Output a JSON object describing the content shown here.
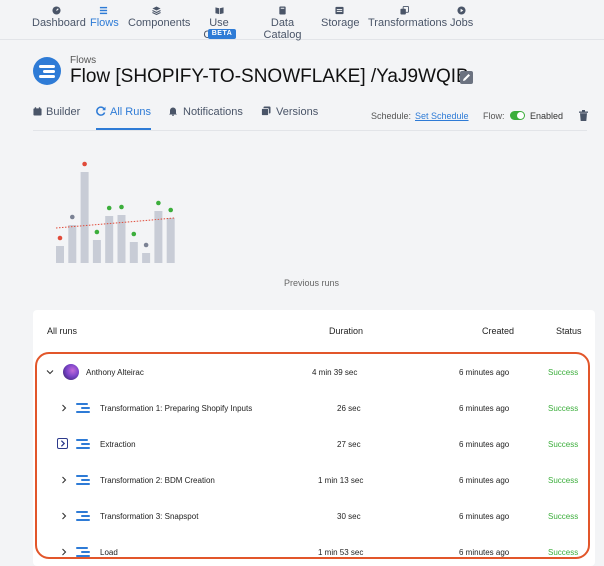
{
  "nav": {
    "items": [
      {
        "label": "Dashboard",
        "icon": "dashboard-icon"
      },
      {
        "label": "Flows",
        "icon": "flows-icon",
        "active": true
      },
      {
        "label": "Components",
        "icon": "components-icon"
      },
      {
        "label": "Use Cases",
        "icon": "use-cases-icon",
        "badge": "BETA"
      },
      {
        "label": "Data Catalog",
        "icon": "data-catalog-icon"
      },
      {
        "label": "Storage",
        "icon": "storage-icon"
      },
      {
        "label": "Transformations",
        "icon": "transformations-icon"
      },
      {
        "label": "Jobs",
        "icon": "jobs-icon"
      }
    ]
  },
  "header": {
    "breadcrumb": "Flows",
    "title": "Flow [SHOPIFY-TO-SNOWFLAKE] /YaJ9WQIB"
  },
  "tabs": [
    {
      "label": "Builder",
      "icon": "builder-icon"
    },
    {
      "label": "All Runs",
      "icon": "refresh-icon",
      "active": true
    },
    {
      "label": "Notifications",
      "icon": "bell-icon"
    },
    {
      "label": "Versions",
      "icon": "versions-icon"
    }
  ],
  "schedule": {
    "label": "Schedule:",
    "link": "Set Schedule",
    "flow_label": "Flow:",
    "enabled_label": "Enabled",
    "enabled": true
  },
  "colors": {
    "accent": "#2e7bd6",
    "success": "#3cae3c",
    "error": "#e04b3a",
    "neutral": "#7b8294",
    "bar": "#c8ccd6",
    "highlight": "#e2562a"
  },
  "chart_data": {
    "type": "bar",
    "caption": "Previous runs",
    "values": [
      17,
      38,
      91,
      23,
      47,
      48,
      21,
      10,
      52,
      45
    ],
    "statuses": [
      "error",
      "neutral",
      "error",
      "success",
      "success",
      "success",
      "success",
      "neutral",
      "success",
      "success"
    ],
    "trendline": {
      "from": 35,
      "to": 45
    },
    "ylim": [
      0,
      100
    ]
  },
  "table": {
    "headers": {
      "name": "All runs",
      "duration": "Duration",
      "created": "Created",
      "status": "Status"
    },
    "run": {
      "user": "Anthony Alteirac",
      "duration": "4 min 39 sec",
      "created": "6 minutes ago",
      "status": "Success"
    },
    "tasks": [
      {
        "name": "Transformation 1: Preparing Shopify Inputs",
        "duration": "26 sec",
        "created": "6 minutes ago",
        "status": "Success"
      },
      {
        "name": "Extraction",
        "duration": "27 sec",
        "created": "6 minutes ago",
        "status": "Success"
      },
      {
        "name": "Transformation 2: BDM Creation",
        "duration": "1 min 13 sec",
        "created": "6 minutes ago",
        "status": "Success"
      },
      {
        "name": "Transformation 3: Snapspot",
        "duration": "30 sec",
        "created": "6 minutes ago",
        "status": "Success"
      },
      {
        "name": "Load",
        "duration": "1 min 53 sec",
        "created": "6 minutes ago",
        "status": "Success"
      }
    ]
  }
}
